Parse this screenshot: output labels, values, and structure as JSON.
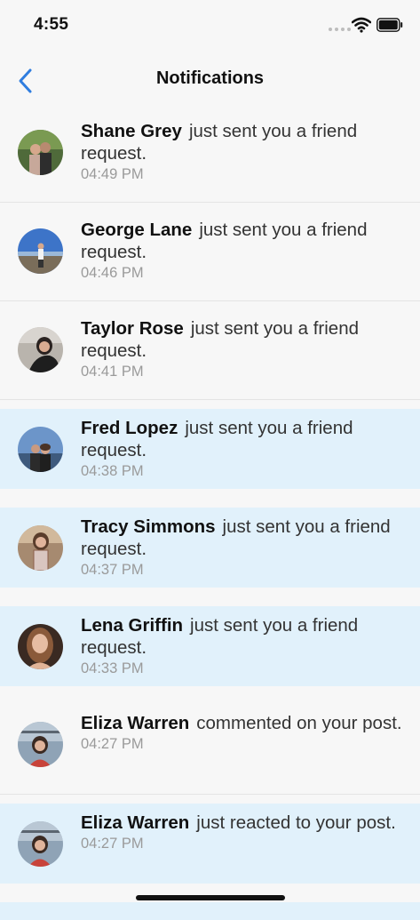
{
  "status_bar": {
    "time": "4:55",
    "icons": [
      "signal-dots-icon",
      "wifi-icon",
      "battery-icon"
    ]
  },
  "nav": {
    "title": "Notifications",
    "back_icon": "chevron-left-icon",
    "accent": "#2f7ddf"
  },
  "colors": {
    "unread_background": "#e1f1fb",
    "read_background": "#f7f7f7",
    "timestamp": "#9a9a9a"
  },
  "notifications": [
    {
      "name": "Shane Grey",
      "action": "just sent you a friend request.",
      "time": "04:49 PM",
      "unread": false
    },
    {
      "name": "George Lane",
      "action": "just sent you a friend request.",
      "time": "04:46 PM",
      "unread": false
    },
    {
      "name": "Taylor Rose",
      "action": "just sent you a friend request.",
      "time": "04:41 PM",
      "unread": false
    },
    {
      "name": "Fred Lopez",
      "action": "just sent you a friend request.",
      "time": "04:38 PM",
      "unread": true
    },
    {
      "name": "Tracy Simmons",
      "action": "just sent you a friend request.",
      "time": "04:37 PM",
      "unread": true
    },
    {
      "name": "Lena Griffin",
      "action": "just sent you a friend request.",
      "time": "04:33 PM",
      "unread": true
    },
    {
      "name": "Eliza Warren",
      "action": "commented on your post.",
      "time": "04:27 PM",
      "unread": false
    },
    {
      "name": "Eliza Warren",
      "action": "just reacted to your post.",
      "time": "04:27 PM",
      "unread": true
    }
  ]
}
